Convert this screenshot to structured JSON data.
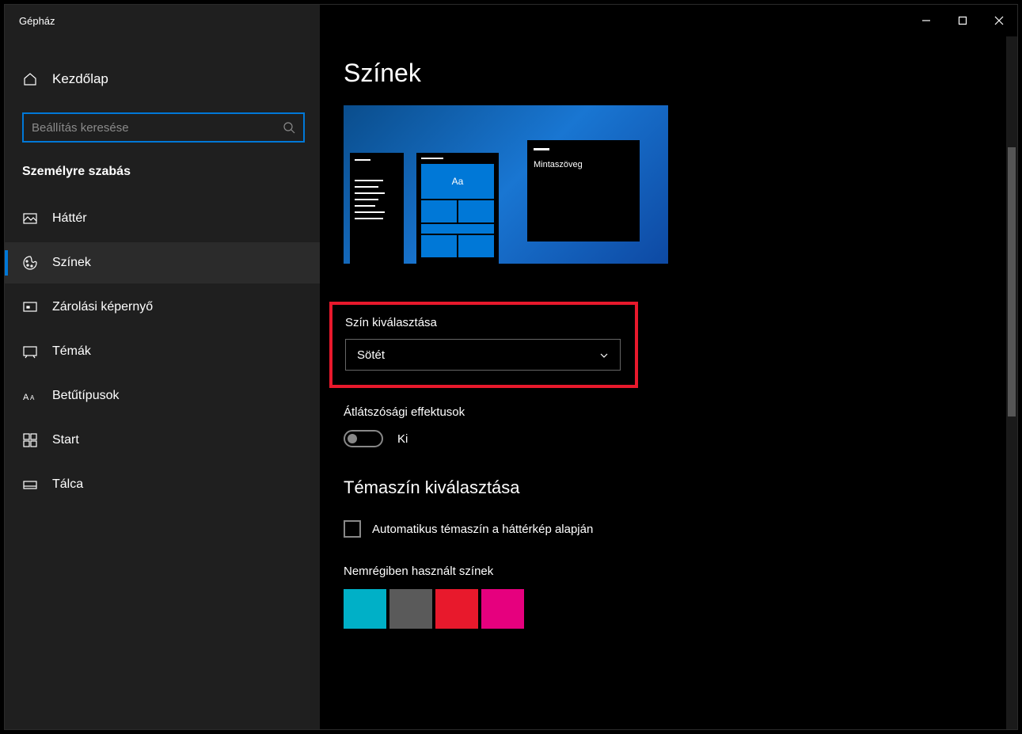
{
  "window": {
    "title": "Gépház"
  },
  "sidebar": {
    "home": "Kezdőlap",
    "search_placeholder": "Beállítás keresése",
    "category": "Személyre szabás",
    "items": [
      {
        "label": "Háttér"
      },
      {
        "label": "Színek"
      },
      {
        "label": "Zárolási képernyő"
      },
      {
        "label": "Témák"
      },
      {
        "label": "Betűtípusok"
      },
      {
        "label": "Start"
      },
      {
        "label": "Tálca"
      }
    ]
  },
  "page": {
    "title": "Színek",
    "preview_sample": "Mintaszöveg",
    "preview_aa": "Aa",
    "color_select_label": "Szín kiválasztása",
    "color_select_value": "Sötét",
    "transparency_label": "Átlátszósági effektusok",
    "transparency_state": "Ki",
    "accent_heading": "Témaszín kiválasztása",
    "auto_accent_label": "Automatikus témaszín a háttérkép alapján",
    "recent_label": "Nemrégiben használt színek",
    "recent_colors": [
      "#00b0c7",
      "#5a5a5a",
      "#e8192c",
      "#e6007e"
    ]
  }
}
